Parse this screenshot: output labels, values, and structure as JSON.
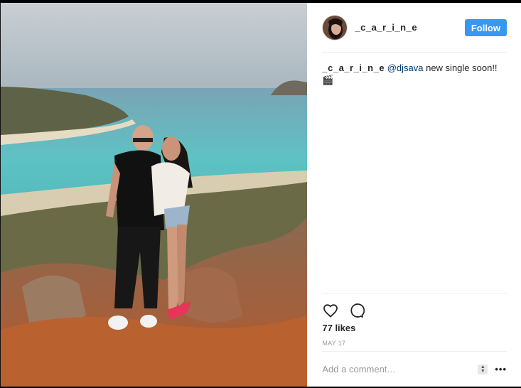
{
  "post": {
    "username": "_c_a_r_i_n_e",
    "follow_label": "Follow",
    "caption": {
      "username": "_c_a_r_i_n_e",
      "mention": "@djsava",
      "text": "new single soon!! 🎬"
    },
    "likes": "77 likes",
    "date": "MAY 17",
    "comment_placeholder": "Add a comment…",
    "more_label": "•••",
    "icons": {
      "like": "heart-icon",
      "comment": "comment-bubble-icon",
      "more": "more-options-icon"
    },
    "colors": {
      "follow_button": "#3897f0",
      "mention": "#003569",
      "meta_text": "#999999"
    }
  }
}
